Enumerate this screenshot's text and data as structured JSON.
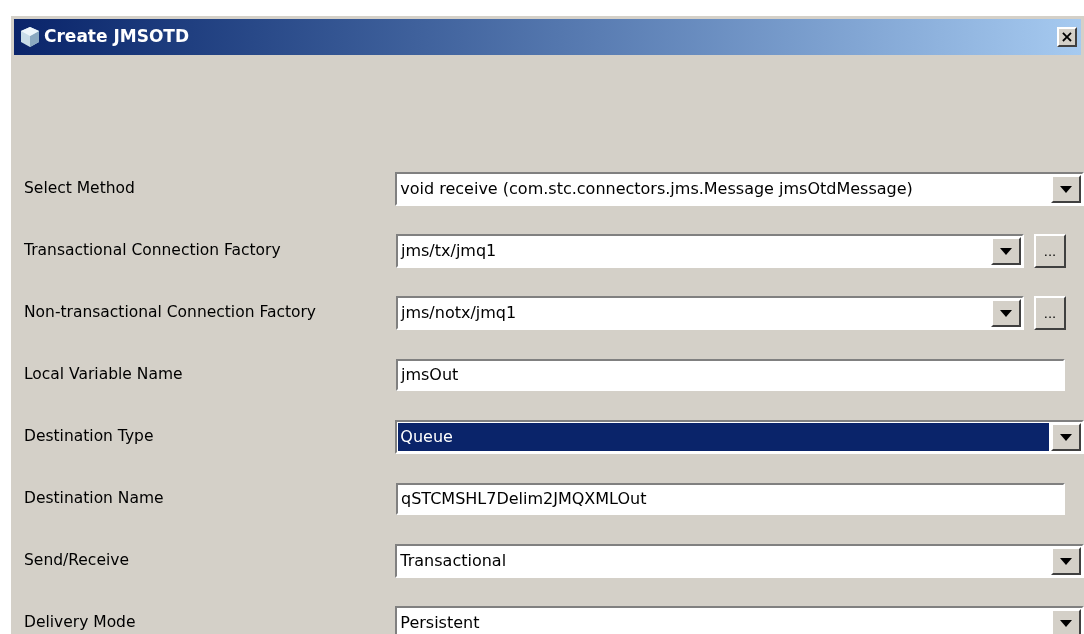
{
  "window": {
    "title": "Create JMSOTD",
    "close_label": "×"
  },
  "fields": [
    {
      "label": "Select Method",
      "kind": "combo",
      "value": "void receive (com.stc.connectors.jms.Message jmsOtdMessage)",
      "highlighted": false
    },
    {
      "label": "Transactional Connection Factory",
      "kind": "combo_browse",
      "value": "jms/tx/jmq1",
      "browse_label": "...",
      "highlighted": false
    },
    {
      "label": "Non-transactional Connection Factory",
      "kind": "combo_browse",
      "value": "jms/notx/jmq1",
      "browse_label": "...",
      "highlighted": false
    },
    {
      "label": "Local Variable Name",
      "kind": "text",
      "value": "jmsOut",
      "highlighted": false
    },
    {
      "label": "Destination Type",
      "kind": "combo",
      "value": "Queue",
      "highlighted": true
    },
    {
      "label": "Destination Name",
      "kind": "text",
      "value": "qSTCMSHL7Delim2JMQXMLOut",
      "highlighted": false
    },
    {
      "label": "Send/Receive",
      "kind": "combo",
      "value": "Transactional",
      "highlighted": false
    },
    {
      "label": "Delivery Mode",
      "kind": "combo",
      "value": "Persistent",
      "highlighted": false
    }
  ]
}
